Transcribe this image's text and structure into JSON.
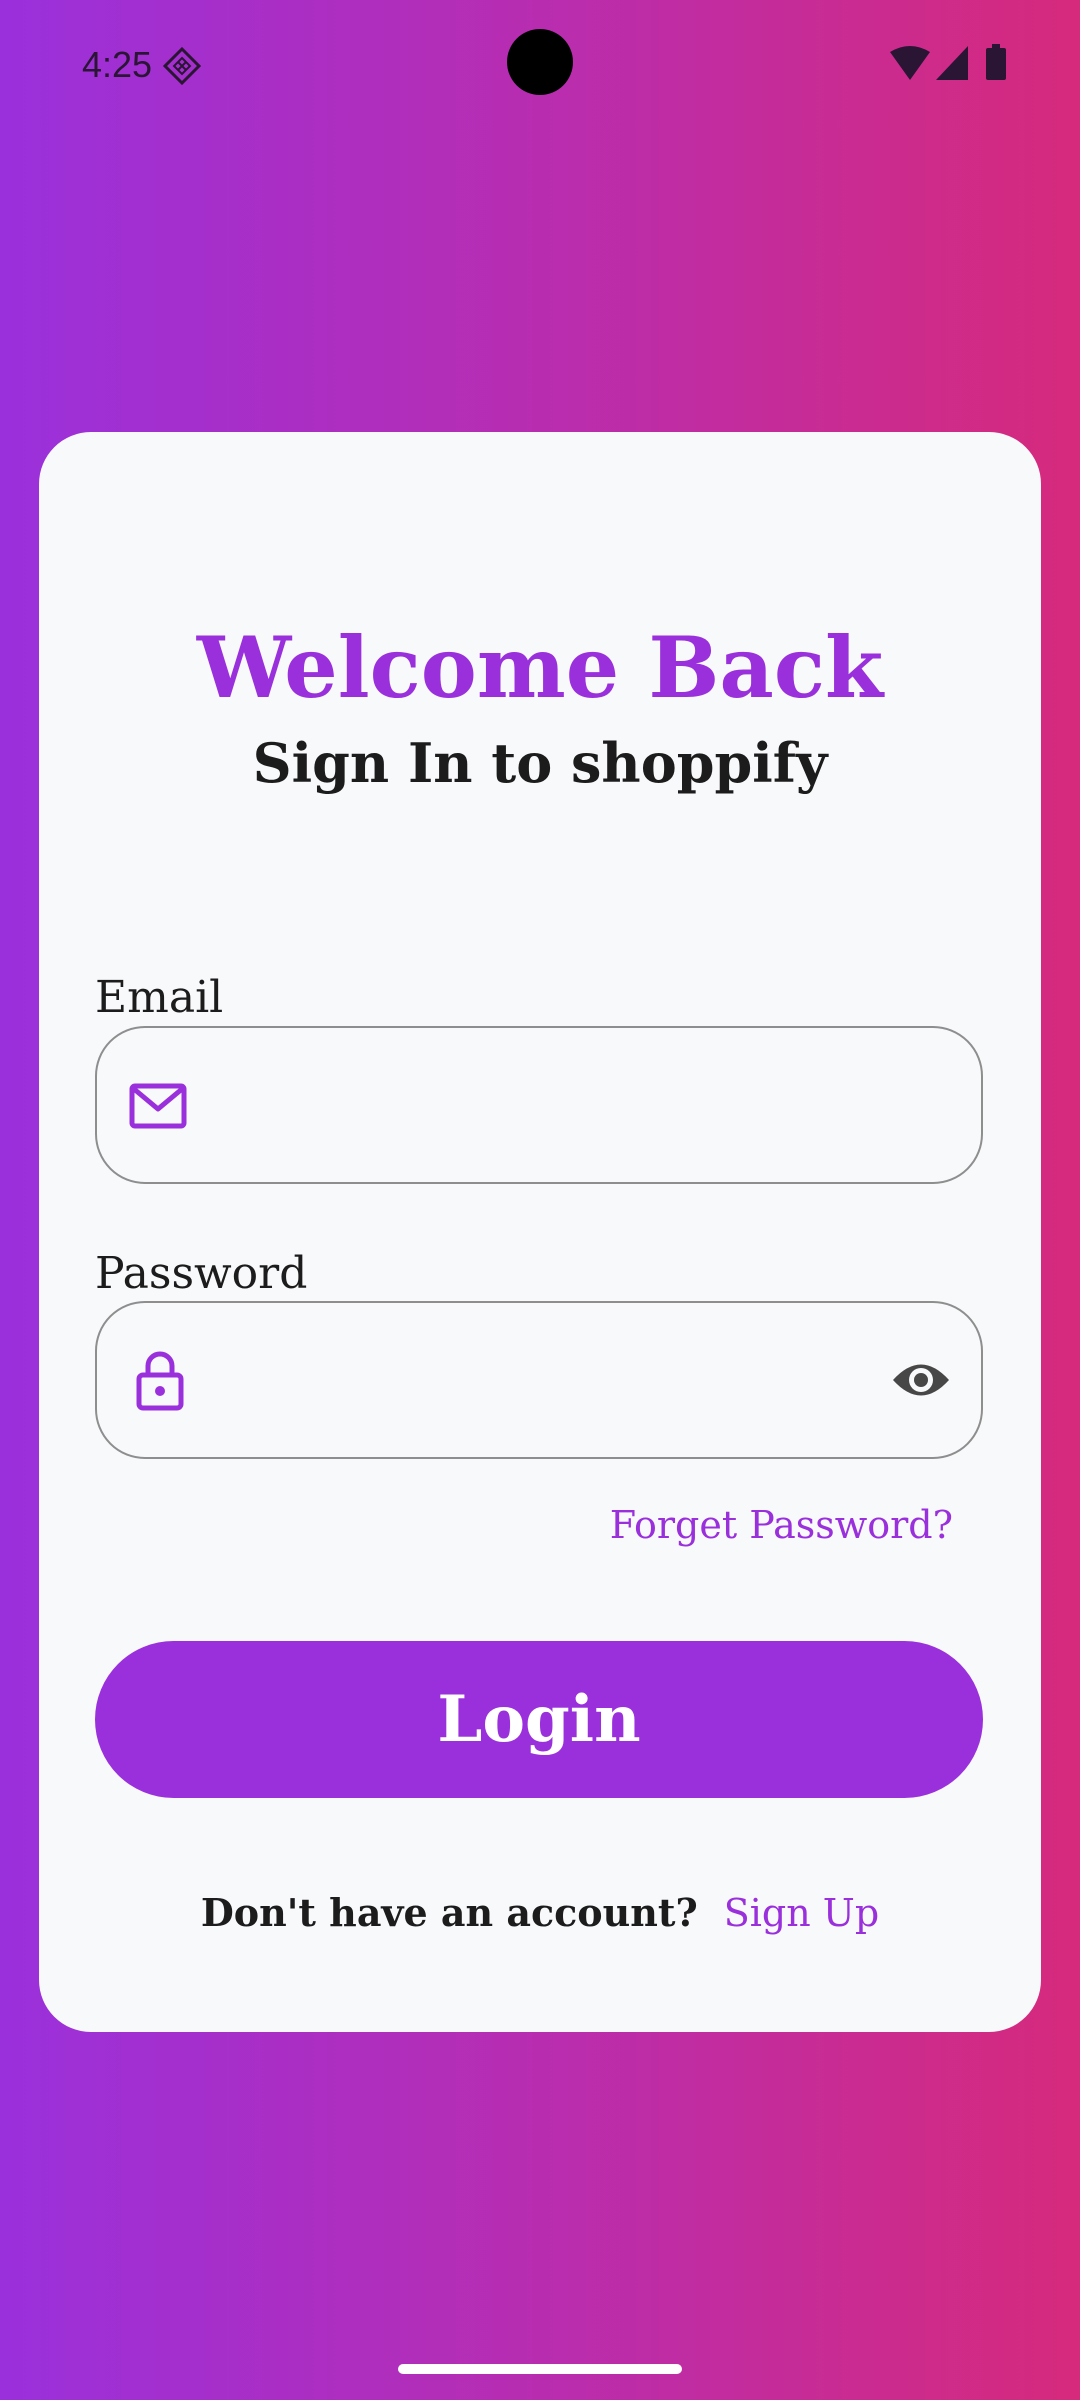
{
  "status_bar": {
    "time": "4:25",
    "icons": [
      "diamond-notification-icon",
      "wifi-icon",
      "cellular-signal-icon",
      "battery-icon"
    ]
  },
  "login_card": {
    "title": "Welcome Back",
    "subtitle": "Sign In to shoppify",
    "email": {
      "label": "Email",
      "value": "",
      "placeholder": "",
      "icon": "mail-icon"
    },
    "password": {
      "label": "Password",
      "value": "",
      "placeholder": "",
      "icon": "lock-icon",
      "toggle_icon": "eye-icon"
    },
    "forgot_password": "Forget Password?",
    "login_button": "Login",
    "signup_prompt": "Don't have an account?",
    "signup_link": "Sign Up"
  },
  "colors": {
    "accent": "#9a30dc",
    "gradient_start": "#9a30dc",
    "gradient_end": "#d62a7c",
    "card_background": "#f8f9fb",
    "text_dark": "#1c1c1c"
  }
}
